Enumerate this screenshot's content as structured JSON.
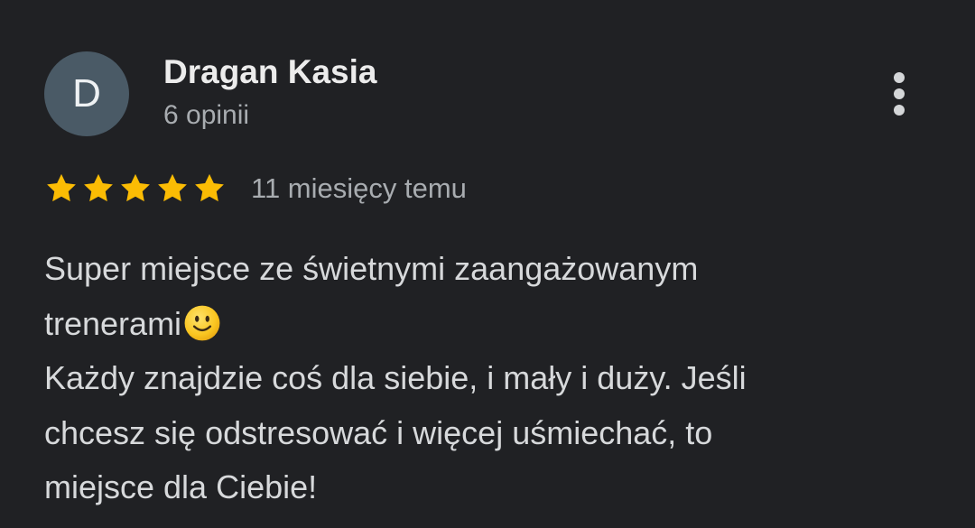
{
  "review": {
    "avatar_letter": "D",
    "avatar_color": "#4a5a66",
    "reviewer_name": "Dragan Kasia",
    "review_count": "6 opinii",
    "more_icon": "more-vertical-icon",
    "rating": 5,
    "rating_max": 5,
    "star_color": "#fbbc04",
    "date": "11 miesięcy temu",
    "text_lines": [
      "Super miejsce ze świetnymi zaangażowanym",
      "trenerami",
      "Każdy znajdzie coś dla siebie, i mały i duży. Jeśli",
      "chcesz się odstresować i więcej uśmiechać, to",
      "miejsce dla Ciebie!"
    ],
    "emoji_icon": "smiling-face-icon"
  }
}
